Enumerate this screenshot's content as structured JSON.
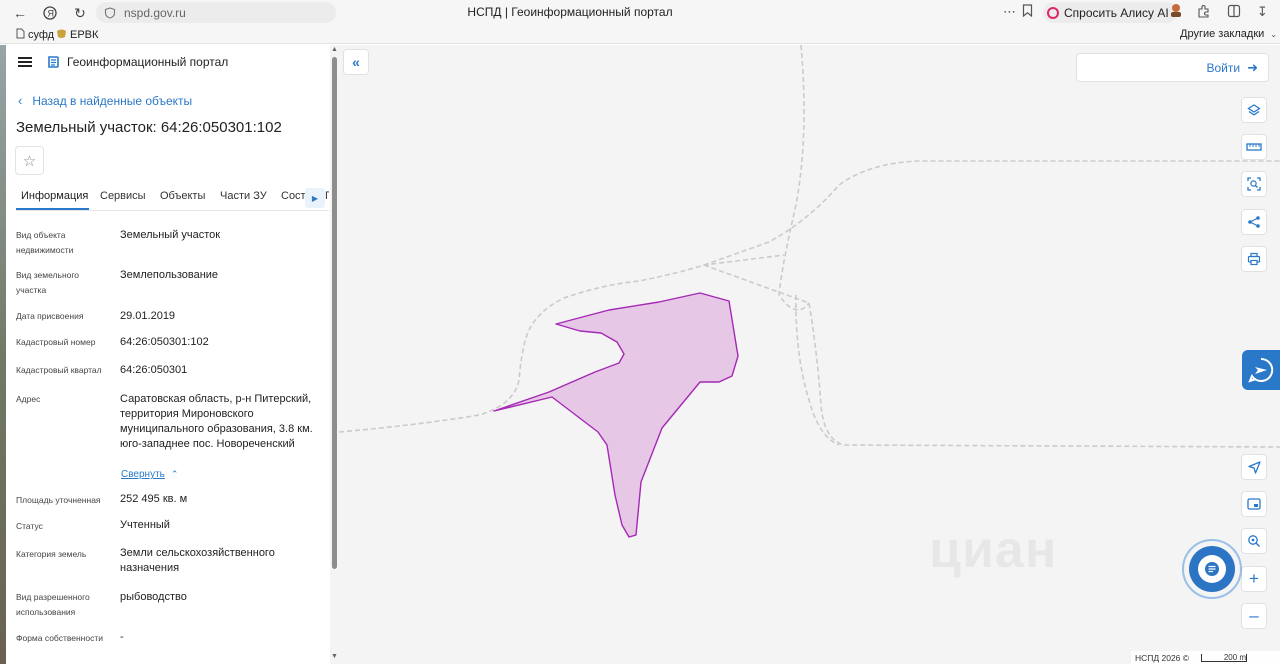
{
  "browser": {
    "url": "nspd.gov.ru",
    "tab_title": "НСПД | Геоинформационный портал",
    "ask_alisa": "Спросить Алису AI",
    "bookmarks": [
      {
        "label": "суфд",
        "icon": "page-icon"
      },
      {
        "label": "ЕРВК",
        "icon": "emblem-icon"
      }
    ],
    "other_bookmarks": "Другие закладки"
  },
  "app": {
    "name": "Геоинформационный портал",
    "back_link": "Назад в найденные объекты",
    "object_title": "Земельный участок: 64:26:050301:102",
    "tabs": [
      "Информация",
      "Сервисы",
      "Объекты",
      "Части ЗУ",
      "Соста",
      "П"
    ],
    "active_tab": "Информация",
    "collapse_label": "Свернуть",
    "login_label": "Войти"
  },
  "details": [
    {
      "label": "Вид объекта недвижимости",
      "value": "Земельный участок"
    },
    {
      "label": "Вид земельного участка",
      "value": "Землепользование"
    },
    {
      "label": "Дата присвоения",
      "value": "29.01.2019"
    },
    {
      "label": "Кадастровый номер",
      "value": "64:26:050301:102"
    },
    {
      "label": "Кадастровый квартал",
      "value": "64:26:050301"
    },
    {
      "label": "Адрес",
      "value": "Саратовская область, р-н Питерский, территория Мироновского муниципального образования, 3.8 км. юго-западнее пос. Новореченский"
    },
    {
      "label": "Площадь уточненная",
      "value": "252 495 кв. м"
    },
    {
      "label": "Статус",
      "value": "Учтенный"
    },
    {
      "label": "Категория земель",
      "value": "Земли сельскохозяйственного назначения"
    },
    {
      "label": "Вид разрешенного использования",
      "value": "рыбоводство"
    },
    {
      "label": "Форма собственности",
      "value": "-"
    }
  ],
  "map": {
    "copyright": "НСПД 2026 ©",
    "scale_label": "200 m",
    "watermark": "циан",
    "parcel_fill": "#e6c8e6",
    "parcel_stroke": "#a429b4",
    "tools": [
      "layers-icon",
      "ruler-icon",
      "select-area-icon",
      "share-icon",
      "print-icon",
      "locate-icon",
      "minimap-icon",
      "search-location-icon",
      "zoom-in-icon",
      "zoom-out-icon"
    ]
  }
}
